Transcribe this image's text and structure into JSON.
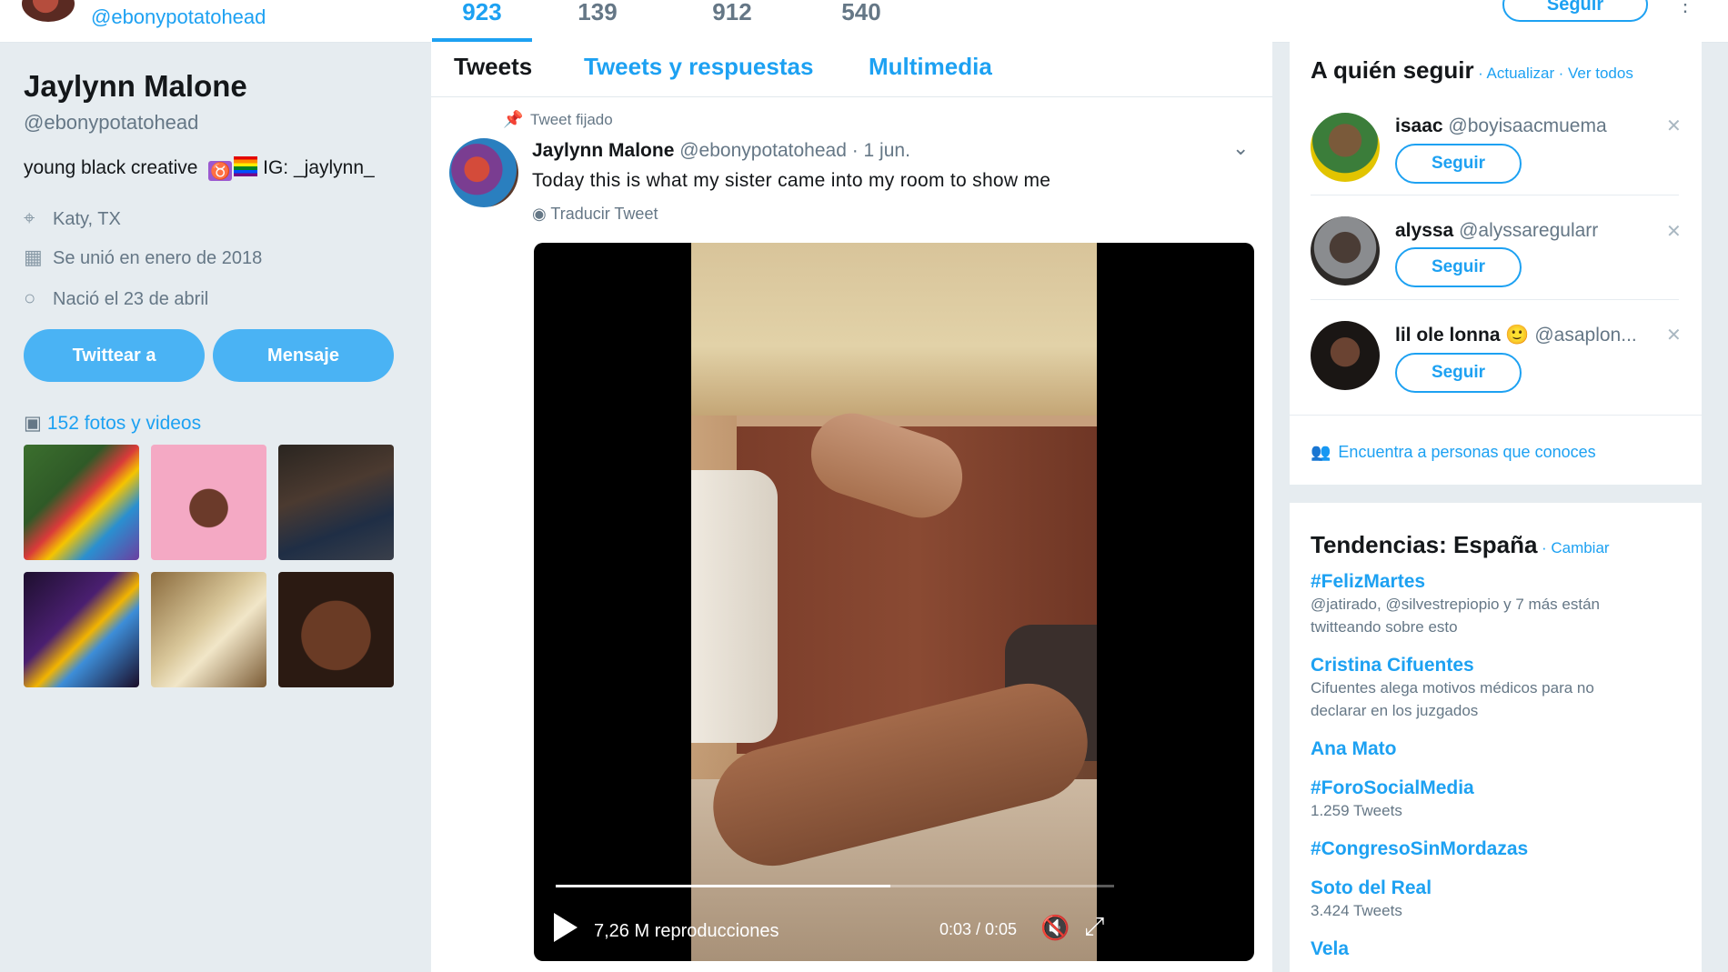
{
  "header": {
    "handle": "@ebonypotatohead",
    "stats": [
      "923",
      "139",
      "912",
      "540"
    ],
    "follow_label": "Seguir"
  },
  "profile": {
    "name": "Jaylynn Malone",
    "handle": "@ebonypotatohead",
    "bio_prefix": "young black creative",
    "bio_suffix": "IG: _jaylynn_",
    "bio_emoji": "♉",
    "location": "Katy, TX",
    "joined": "Se unió en enero de 2018",
    "born": "Nació el 23 de abril",
    "tweet_to_label": "Twittear a",
    "message_label": "Mensaje",
    "photos_label": "152 fotos y videos"
  },
  "tabs": [
    "Tweets",
    "Tweets y respuestas",
    "Multimedia"
  ],
  "tweet": {
    "pinned_label": "Tweet fijado",
    "author_name": "Jaylynn Malone",
    "author_handle": "@ebonypotatohead",
    "date": "· 1 jun.",
    "text": "Today this is what my sister came into my room to show me",
    "translate_label": "Traducir Tweet",
    "video": {
      "views": "7,26 M reproducciones",
      "time": "0:03 / 0:05",
      "progress": 0.6
    }
  },
  "who_to_follow": {
    "title": "A quién seguir",
    "refresh": "· Actualizar",
    "view_all": "· Ver todos",
    "follow_label": "Seguir",
    "users": [
      {
        "name": "isaac",
        "handle": "@boyisaacmuema"
      },
      {
        "name": "alyssa",
        "handle": "@alyssaregularr"
      },
      {
        "name": "lil ole lonna",
        "emoji": "🙂",
        "handle": "@asaplon..."
      }
    ],
    "find_people": "Encuentra a personas que conoces"
  },
  "trends": {
    "title": "Tendencias: España",
    "change": "· Cambiar",
    "items": [
      {
        "name": "#FelizMartes",
        "sub1": "@jatirado, @silvestrepiopio y 7 más están",
        "sub2": "twitteando sobre esto"
      },
      {
        "name": "Cristina Cifuentes",
        "sub1": "Cifuentes alega motivos médicos para no",
        "sub2": "declarar en los juzgados"
      },
      {
        "name": "Ana Mato"
      },
      {
        "name": "#ForoSocialMedia",
        "sub1": "1.259 Tweets"
      },
      {
        "name": "#CongresoSinMordazas"
      },
      {
        "name": "Soto del Real",
        "sub1": "3.424 Tweets"
      },
      {
        "name": "Vela"
      }
    ]
  }
}
